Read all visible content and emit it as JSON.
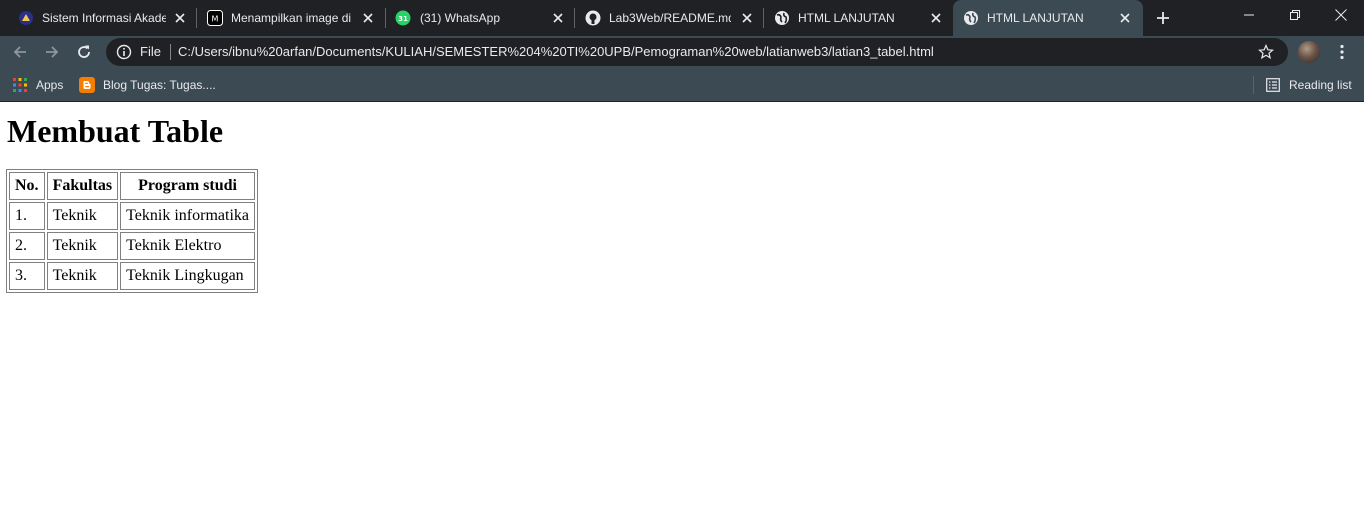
{
  "browser": {
    "tabs": [
      {
        "title": "Sistem Informasi Akade",
        "icon": "university-logo-icon",
        "active": false
      },
      {
        "title": "Menampilkan image di",
        "icon": "site-logo-icon",
        "active": false
      },
      {
        "title": "(31) WhatsApp",
        "icon": "whatsapp-icon",
        "badge": "31",
        "active": false
      },
      {
        "title": "Lab3Web/README.md",
        "icon": "github-icon",
        "active": false
      },
      {
        "title": "HTML LANJUTAN",
        "icon": "globe-icon",
        "active": false
      },
      {
        "title": "HTML LANJUTAN",
        "icon": "globe-icon",
        "active": true
      }
    ],
    "omnibox": {
      "scheme_label": "File",
      "url": "C:/Users/ibnu%20arfan/Documents/KULIAH/SEMESTER%204%20TI%20UPB/Pemograman%20web/latianweb3/latian3_tabel.html"
    },
    "bookmarks": {
      "apps_label": "Apps",
      "blog_label": "Blog Tugas: Tugas....",
      "reading_list_label": "Reading list"
    },
    "colors": {
      "frame": "#202124",
      "toolbar": "#3c4a54",
      "text": "#e8eaed"
    }
  },
  "page": {
    "heading": "Membuat Table",
    "table": {
      "headers": [
        "No.",
        "Fakultas",
        "Program studi"
      ],
      "rows": [
        [
          "1.",
          "Teknik",
          "Teknik informatika"
        ],
        [
          "2.",
          "Teknik",
          "Teknik Elektro"
        ],
        [
          "3.",
          "Teknik",
          "Teknik Lingkugan"
        ]
      ]
    }
  }
}
